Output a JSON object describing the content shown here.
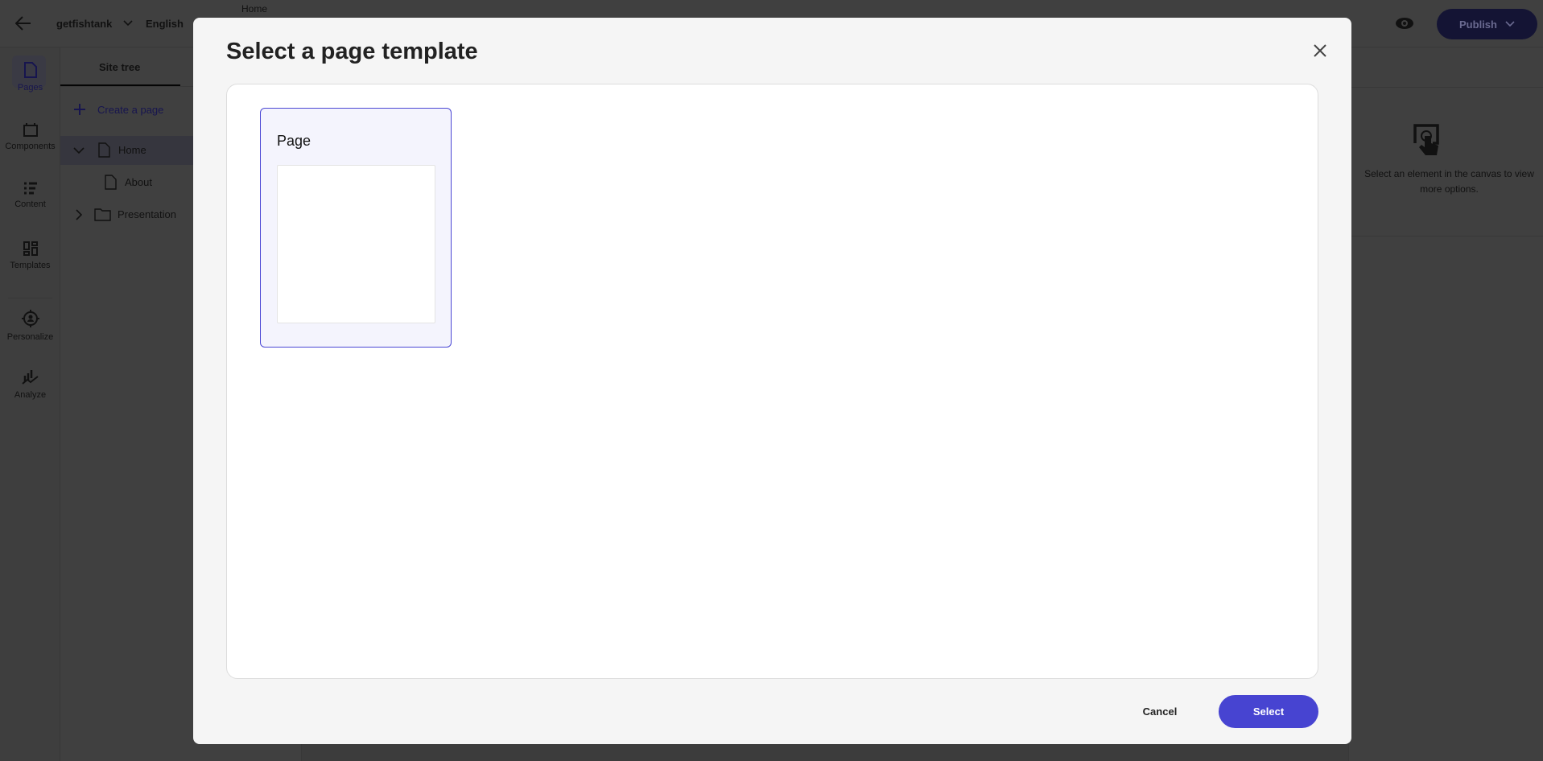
{
  "topbar": {
    "site": "getfishtank",
    "language": "English",
    "page": "Home",
    "publish_label": "Publish"
  },
  "rail": {
    "items": [
      {
        "label": "Pages",
        "icon": "page-icon"
      },
      {
        "label": "Components",
        "icon": "components-icon"
      },
      {
        "label": "Content",
        "icon": "content-icon"
      },
      {
        "label": "Templates",
        "icon": "templates-icon"
      },
      {
        "label": "Personalize",
        "icon": "personalize-icon"
      },
      {
        "label": "Analyze",
        "icon": "analyze-icon"
      }
    ]
  },
  "tree": {
    "tab": "Site tree",
    "create_label": "Create a page",
    "items": [
      {
        "label": "Home",
        "type": "page",
        "expanded": true,
        "selected": true
      },
      {
        "label": "About",
        "type": "page"
      },
      {
        "label": "Presentation",
        "type": "folder",
        "expanded": false
      }
    ]
  },
  "right_panel": {
    "hint": "Select an element in the canvas to view more options."
  },
  "modal": {
    "title": "Select a page template",
    "templates": [
      {
        "name": "Page",
        "selected": true
      }
    ],
    "cancel_label": "Cancel",
    "select_label": "Select"
  },
  "colors": {
    "accent": "#4744d1",
    "publish": "#1d1a7a"
  }
}
